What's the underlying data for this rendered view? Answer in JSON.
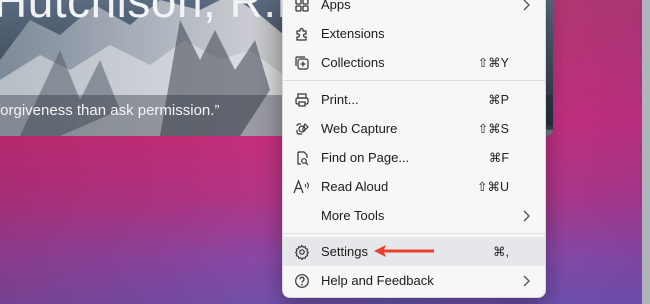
{
  "background": {
    "heading": "Hutchison, R.P.",
    "quote": "forgiveness than ask permission.”"
  },
  "menu": {
    "items": [
      {
        "label": "Apps",
        "shortcut": "",
        "has_submenu": true,
        "icon": "apps-icon"
      },
      {
        "label": "Extensions",
        "shortcut": "",
        "has_submenu": false,
        "icon": "puzzle-icon"
      },
      {
        "label": "Collections",
        "shortcut": "⇧⌘Y",
        "has_submenu": false,
        "icon": "collections-icon"
      },
      {
        "label": "Print...",
        "shortcut": "⌘P",
        "has_submenu": false,
        "icon": "printer-icon"
      },
      {
        "label": "Web Capture",
        "shortcut": "⇧⌘S",
        "has_submenu": false,
        "icon": "web-capture-icon"
      },
      {
        "label": "Find on Page...",
        "shortcut": "⌘F",
        "has_submenu": false,
        "icon": "find-on-page-icon"
      },
      {
        "label": "Read Aloud",
        "shortcut": "⇧⌘U",
        "has_submenu": false,
        "icon": "read-aloud-icon"
      },
      {
        "label": "More Tools",
        "shortcut": "",
        "has_submenu": true,
        "icon": ""
      },
      {
        "label": "Settings",
        "shortcut": "⌘,",
        "has_submenu": false,
        "icon": "gear-icon"
      },
      {
        "label": "Help and Feedback",
        "shortcut": "",
        "has_submenu": true,
        "icon": "help-icon"
      }
    ]
  },
  "annotation": {
    "arrow_color": "#e8412b",
    "target": "Settings"
  },
  "colors": {
    "menu_background": "#f7f7f8",
    "highlight": "#e6e7ea",
    "text": "#1b1b1b"
  }
}
